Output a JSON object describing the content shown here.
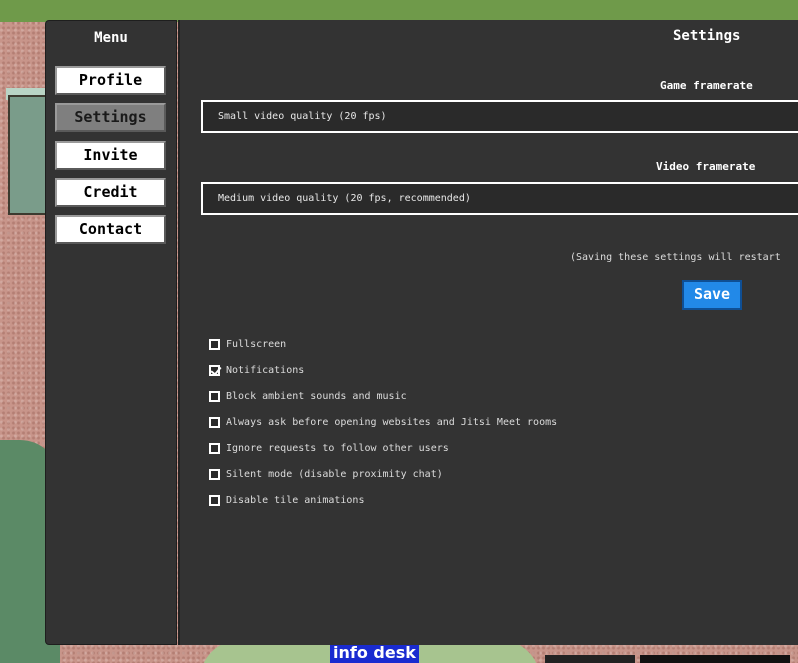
{
  "background": {
    "map_label": "info desk"
  },
  "sidebar": {
    "title": "Menu",
    "items": [
      {
        "label": "Profile",
        "active": false
      },
      {
        "label": "Settings",
        "active": true
      },
      {
        "label": "Invite",
        "active": false
      },
      {
        "label": "Credit",
        "active": false
      },
      {
        "label": "Contact",
        "active": false
      }
    ]
  },
  "settings": {
    "title": "Settings",
    "game_framerate": {
      "label": "Game framerate",
      "selected": "Small video quality (20 fps)"
    },
    "video_framerate": {
      "label": "Video framerate",
      "selected": "Medium video quality (20 fps, recommended)"
    },
    "restart_note": "(Saving these settings will restart",
    "save_label": "Save",
    "options": [
      {
        "label": "Fullscreen",
        "checked": false
      },
      {
        "label": "Notifications",
        "checked": true
      },
      {
        "label": "Block ambient sounds and music",
        "checked": false
      },
      {
        "label": "Always ask before opening websites and Jitsi Meet rooms",
        "checked": false
      },
      {
        "label": "Ignore requests to follow other users",
        "checked": false
      },
      {
        "label": "Silent mode (disable proximity chat)",
        "checked": false
      },
      {
        "label": "Disable tile animations",
        "checked": false
      }
    ]
  },
  "colors": {
    "panel_bg": "#333333",
    "accent": "#2289e8",
    "active_menu": "#7f7f7f",
    "map_label_bg": "#1a2bd0"
  }
}
